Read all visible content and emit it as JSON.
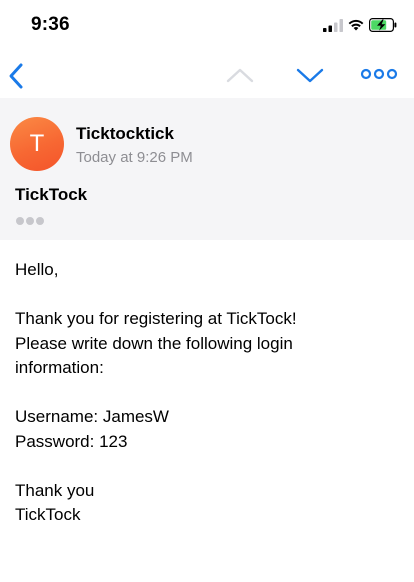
{
  "status_bar": {
    "time": "9:36",
    "icons": [
      "cellular-signal-icon",
      "wifi-icon",
      "battery-charging-icon"
    ]
  },
  "nav": {
    "back_icon": "chevron-left-icon",
    "prev_icon": "chevron-up-icon",
    "next_icon": "chevron-down-icon",
    "more_icon": "more-horizontal-icon",
    "accent_color": "#1a7ae8",
    "disabled_color": "#d9dbe0"
  },
  "email": {
    "avatar_letter": "T",
    "sender": "Ticktocktick",
    "date": "Today at 9:26 PM",
    "subject": "TickTock",
    "body_lines": [
      "Hello,",
      "",
      "Thank you for registering at TickTock!",
      "Please write down the following login",
      "information:",
      "",
      "Username: JamesW",
      "Password: 123",
      "",
      "Thank you",
      "TickTock"
    ]
  },
  "colors": {
    "header_bg": "#f5f5f7",
    "avatar_orange": "#f76833",
    "secondary_text": "#8e8e93"
  }
}
